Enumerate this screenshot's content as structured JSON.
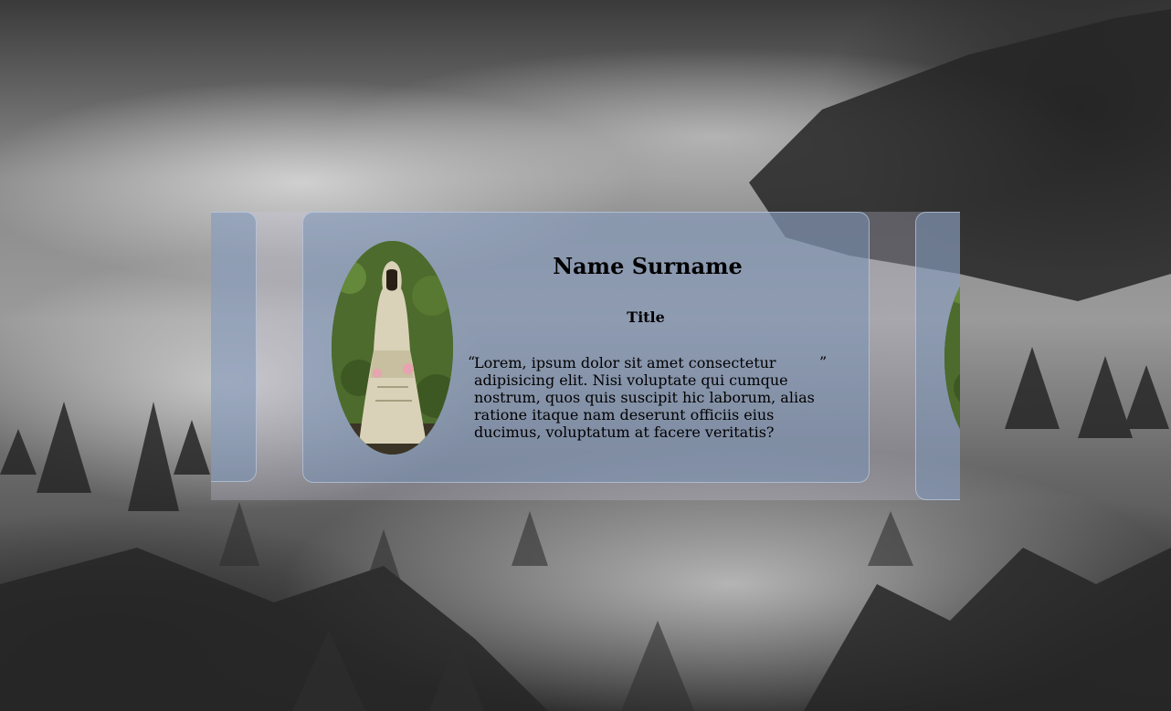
{
  "testimonial": {
    "name": "Name Surname",
    "title": "Title",
    "quote_open": "“",
    "quote_text": "Lorem, ipsum dolor sit amet consectetur adipisicing elit. Nisi voluptate qui cumque nostrum, quos quis suscipit hic laborum, alias ratione itaque nam deserunt officiis eius ducimus, voluptatum at facere veritatis?",
    "quote_close": "”"
  },
  "left_card": {
    "quote_close": "”"
  },
  "icons": {
    "avatar": "person-photo-icon"
  },
  "colors": {
    "card": "#7891b4",
    "band": "#cdc8e1"
  }
}
